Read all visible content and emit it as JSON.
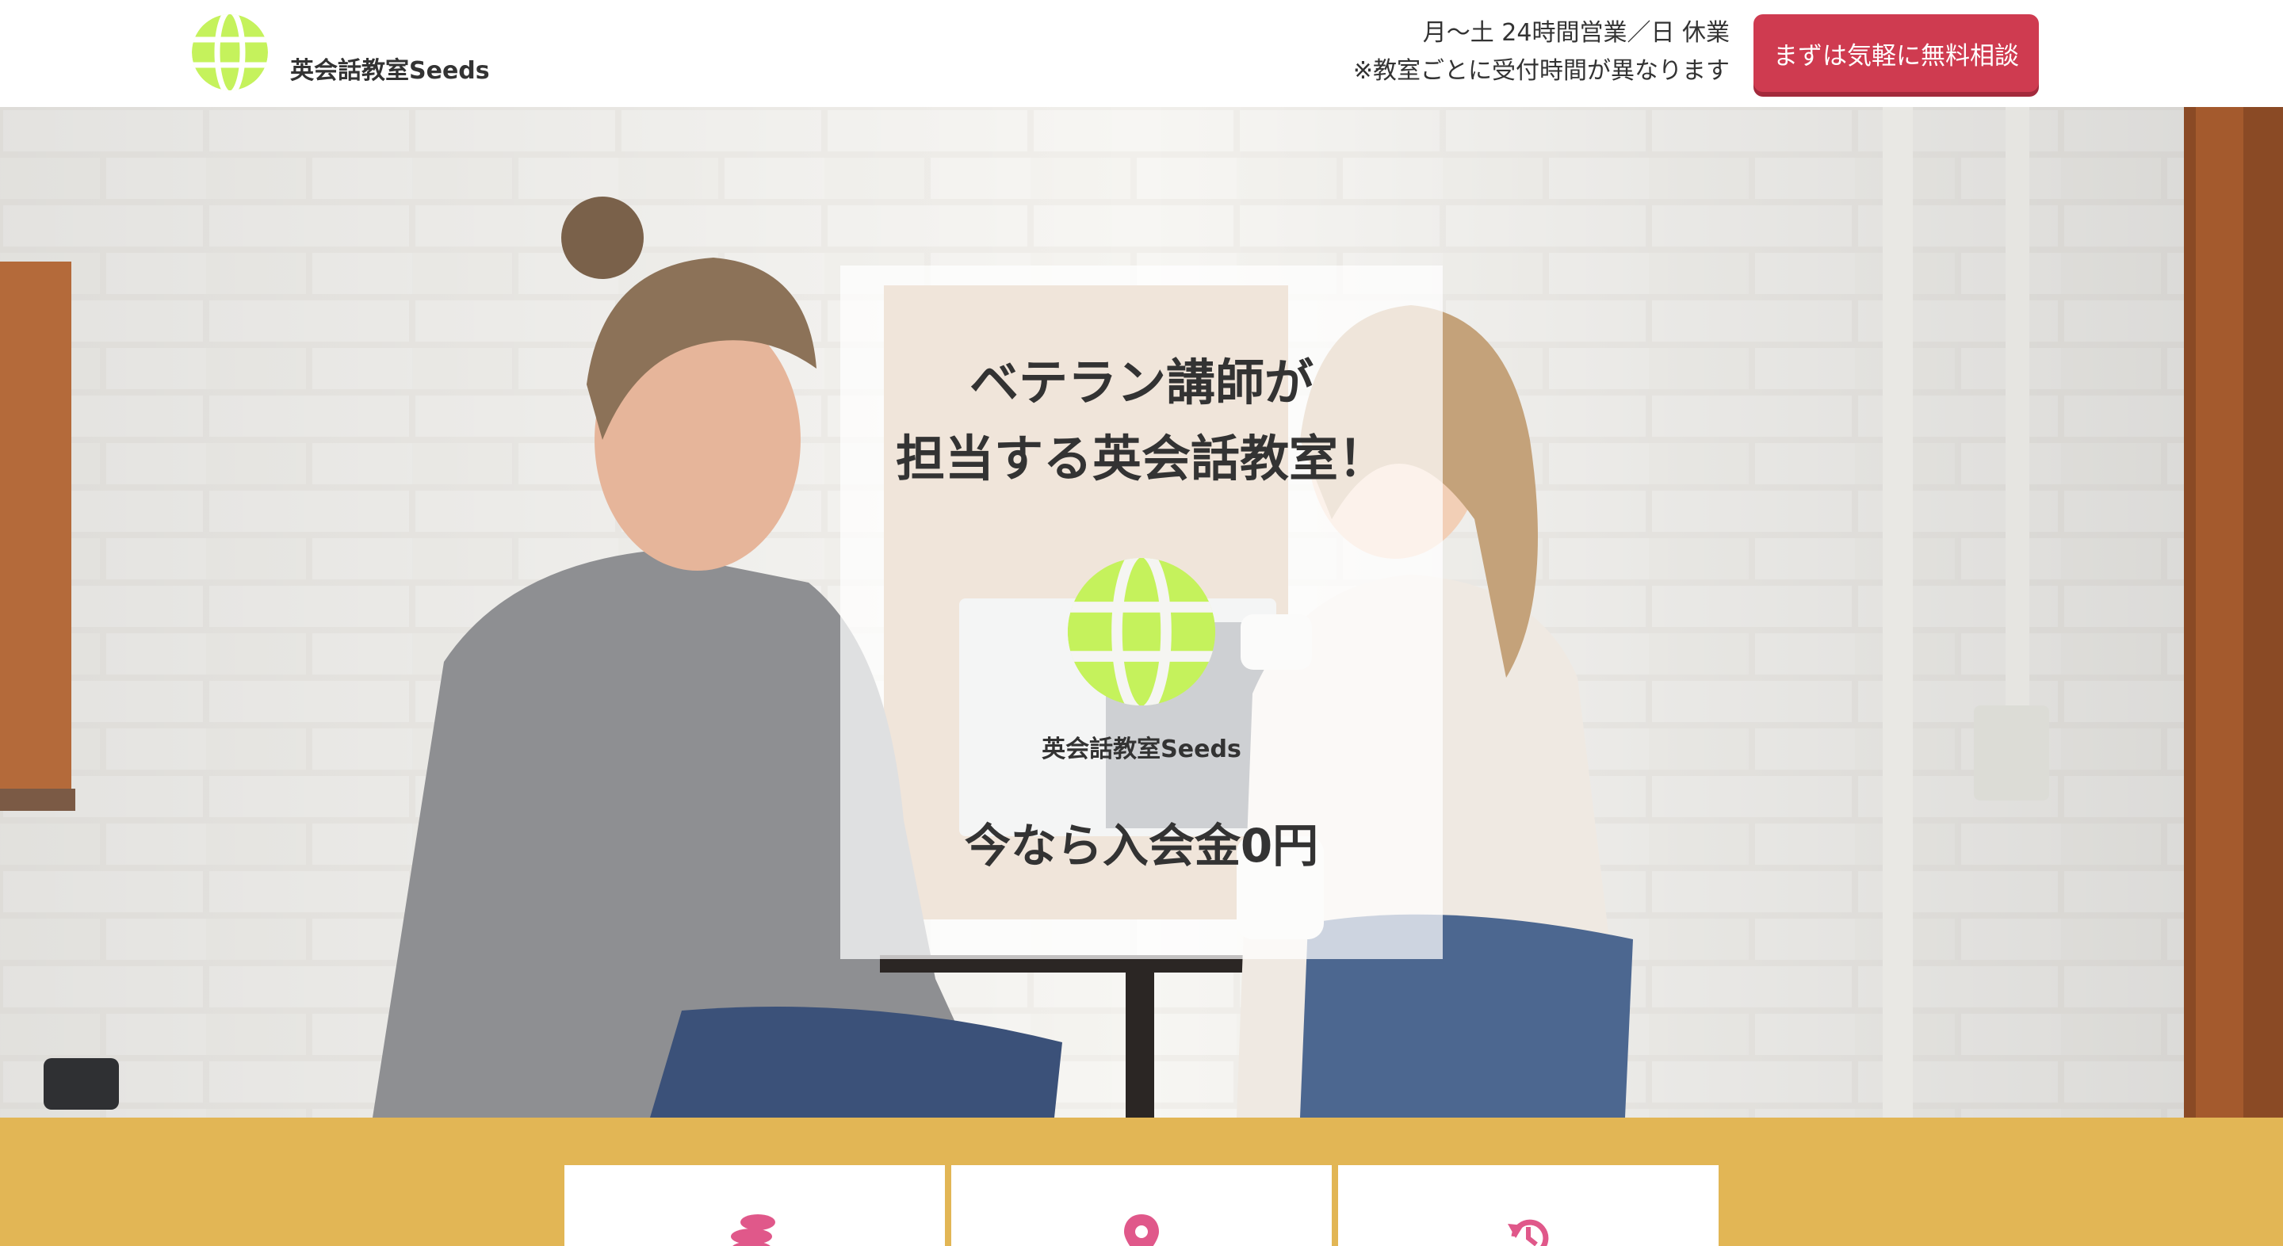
{
  "header": {
    "logo_icon": "globe-icon",
    "brand": "英会話教室Seeds",
    "hours_line1": "月〜土 24時間営業／日 休業",
    "hours_line2": "※教室ごとに受付時間が異なります",
    "cta_label": "まずは気軽に無料相談"
  },
  "hero": {
    "headline_line1": "ベテラン講師が",
    "headline_line2": "担当する英会話教室！",
    "brand": "英会話教室Seeds",
    "promo": "今なら入会金0円"
  },
  "feature_cards": [
    {
      "icon": "coins-icon"
    },
    {
      "icon": "map-pin-icon"
    },
    {
      "icon": "history-icon"
    }
  ],
  "colors": {
    "accent": "#cf3b50",
    "globe": "#c5f25c",
    "band": "#e2b655",
    "card_icon": "#e0588a"
  }
}
